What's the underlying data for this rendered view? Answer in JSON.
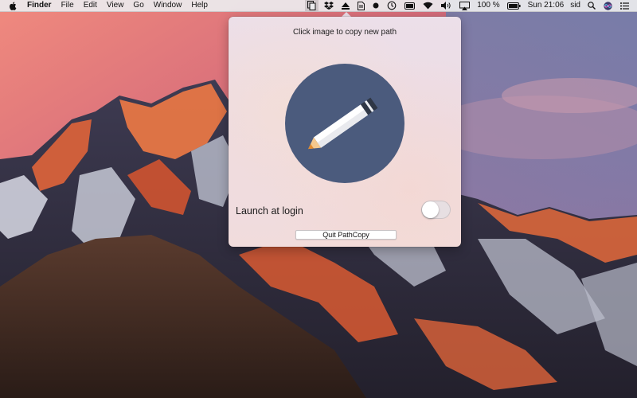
{
  "menubar": {
    "app_name": "Finder",
    "menus": [
      "File",
      "Edit",
      "View",
      "Go",
      "Window",
      "Help"
    ],
    "status_icons": [
      "pathcopy-icon",
      "dropbox-icon",
      "eject-icon",
      "document-icon",
      "record-dot-icon",
      "time-machine-icon",
      "battery-meter-icon",
      "wifi-icon",
      "volume-icon",
      "airplay-icon"
    ],
    "battery_percent": "100 %",
    "clock": "Sun 21:06",
    "user": "sid",
    "right_icons": [
      "search-icon",
      "siri-icon",
      "notification-center-icon"
    ]
  },
  "popover": {
    "instruction": "Click image to copy new path",
    "image_icon": "pencil-icon",
    "image_colors": {
      "circle": "#4b5b7d"
    },
    "launch_at_login_label": "Launch at login",
    "launch_at_login_enabled": false,
    "quit_button_label": "Quit PathCopy"
  }
}
